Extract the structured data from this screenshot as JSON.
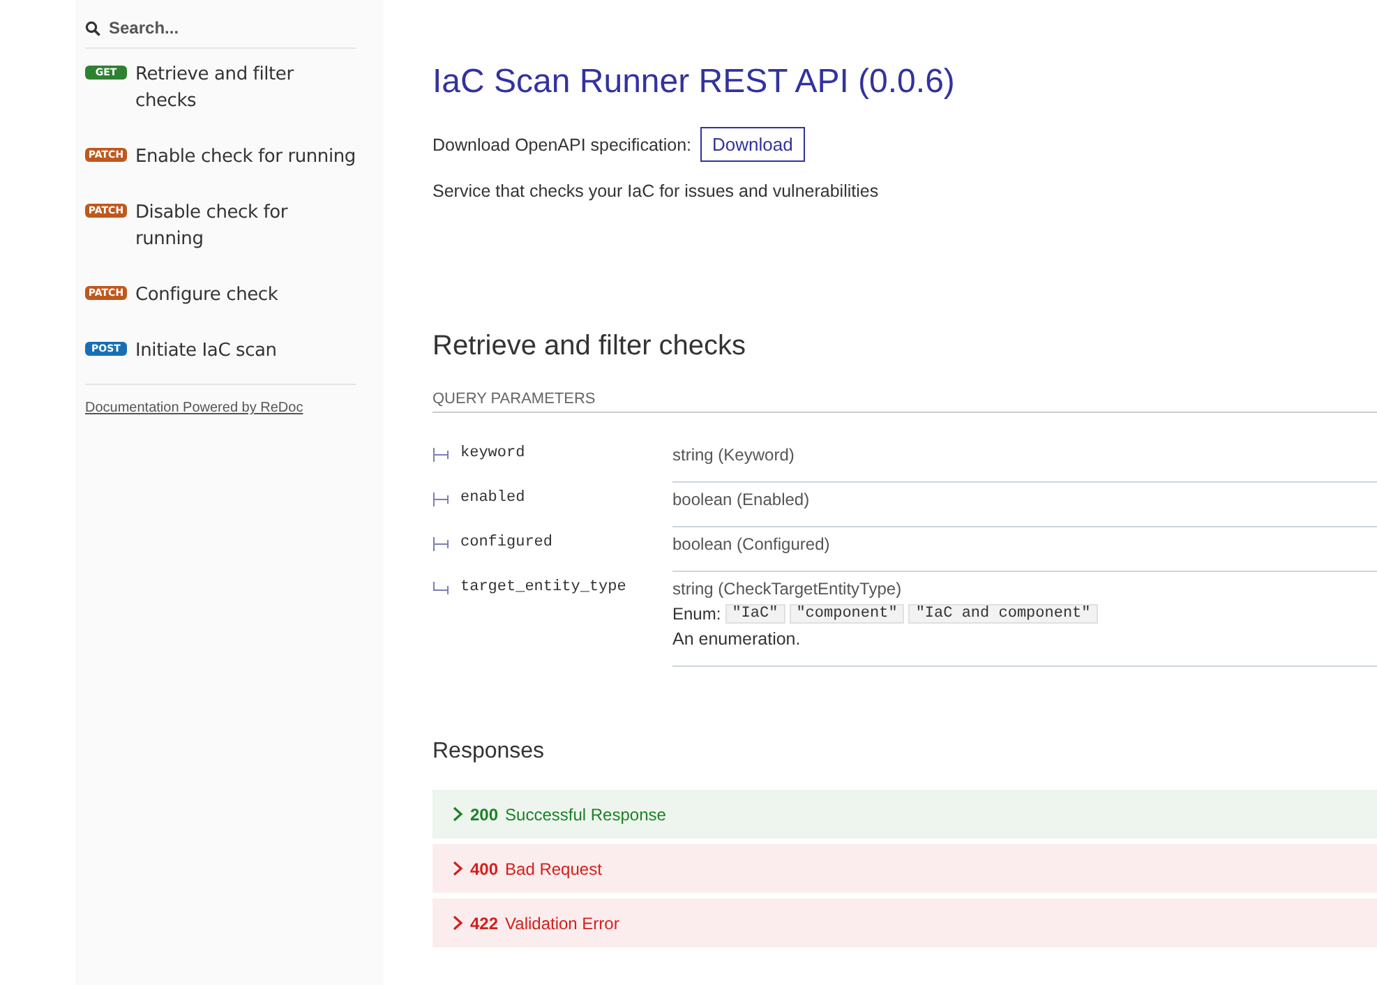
{
  "sidebar": {
    "search": {
      "placeholder": "Search..."
    },
    "items": [
      {
        "method": "GET",
        "kind": "get",
        "label": "Retrieve and filter checks"
      },
      {
        "method": "PATCH",
        "kind": "patch",
        "label": "Enable check for running"
      },
      {
        "method": "PATCH",
        "kind": "patch",
        "label": "Disable check for running"
      },
      {
        "method": "PATCH",
        "kind": "patch",
        "label": "Configure check"
      },
      {
        "method": "POST",
        "kind": "post",
        "label": "Initiate IaC scan"
      }
    ],
    "footer_link": "Documentation Powered by ReDoc"
  },
  "main": {
    "title": "IaC Scan Runner REST API (0.0.6)",
    "download_label": "Download OpenAPI specification:",
    "download_button": "Download",
    "description": "Service that checks your IaC for issues and vulnerabilities",
    "operation": {
      "title": "Retrieve and filter checks",
      "params_heading": "QUERY PARAMETERS",
      "params": [
        {
          "name": "keyword",
          "type": "string (Keyword)"
        },
        {
          "name": "enabled",
          "type": "boolean (Enabled)"
        },
        {
          "name": "configured",
          "type": "boolean (Configured)"
        },
        {
          "name": "target_entity_type",
          "type": "string (CheckTargetEntityType)",
          "enum_label": "Enum:",
          "enum": [
            "\"IaC\"",
            "\"component\"",
            "\"IaC and component\""
          ],
          "note": "An enumeration."
        }
      ],
      "responses_title": "Responses",
      "responses": [
        {
          "kind": "success",
          "code": "200",
          "text": "Successful Response"
        },
        {
          "kind": "error",
          "code": "400",
          "text": "Bad Request"
        },
        {
          "kind": "error",
          "code": "422",
          "text": "Validation Error"
        }
      ]
    }
  }
}
